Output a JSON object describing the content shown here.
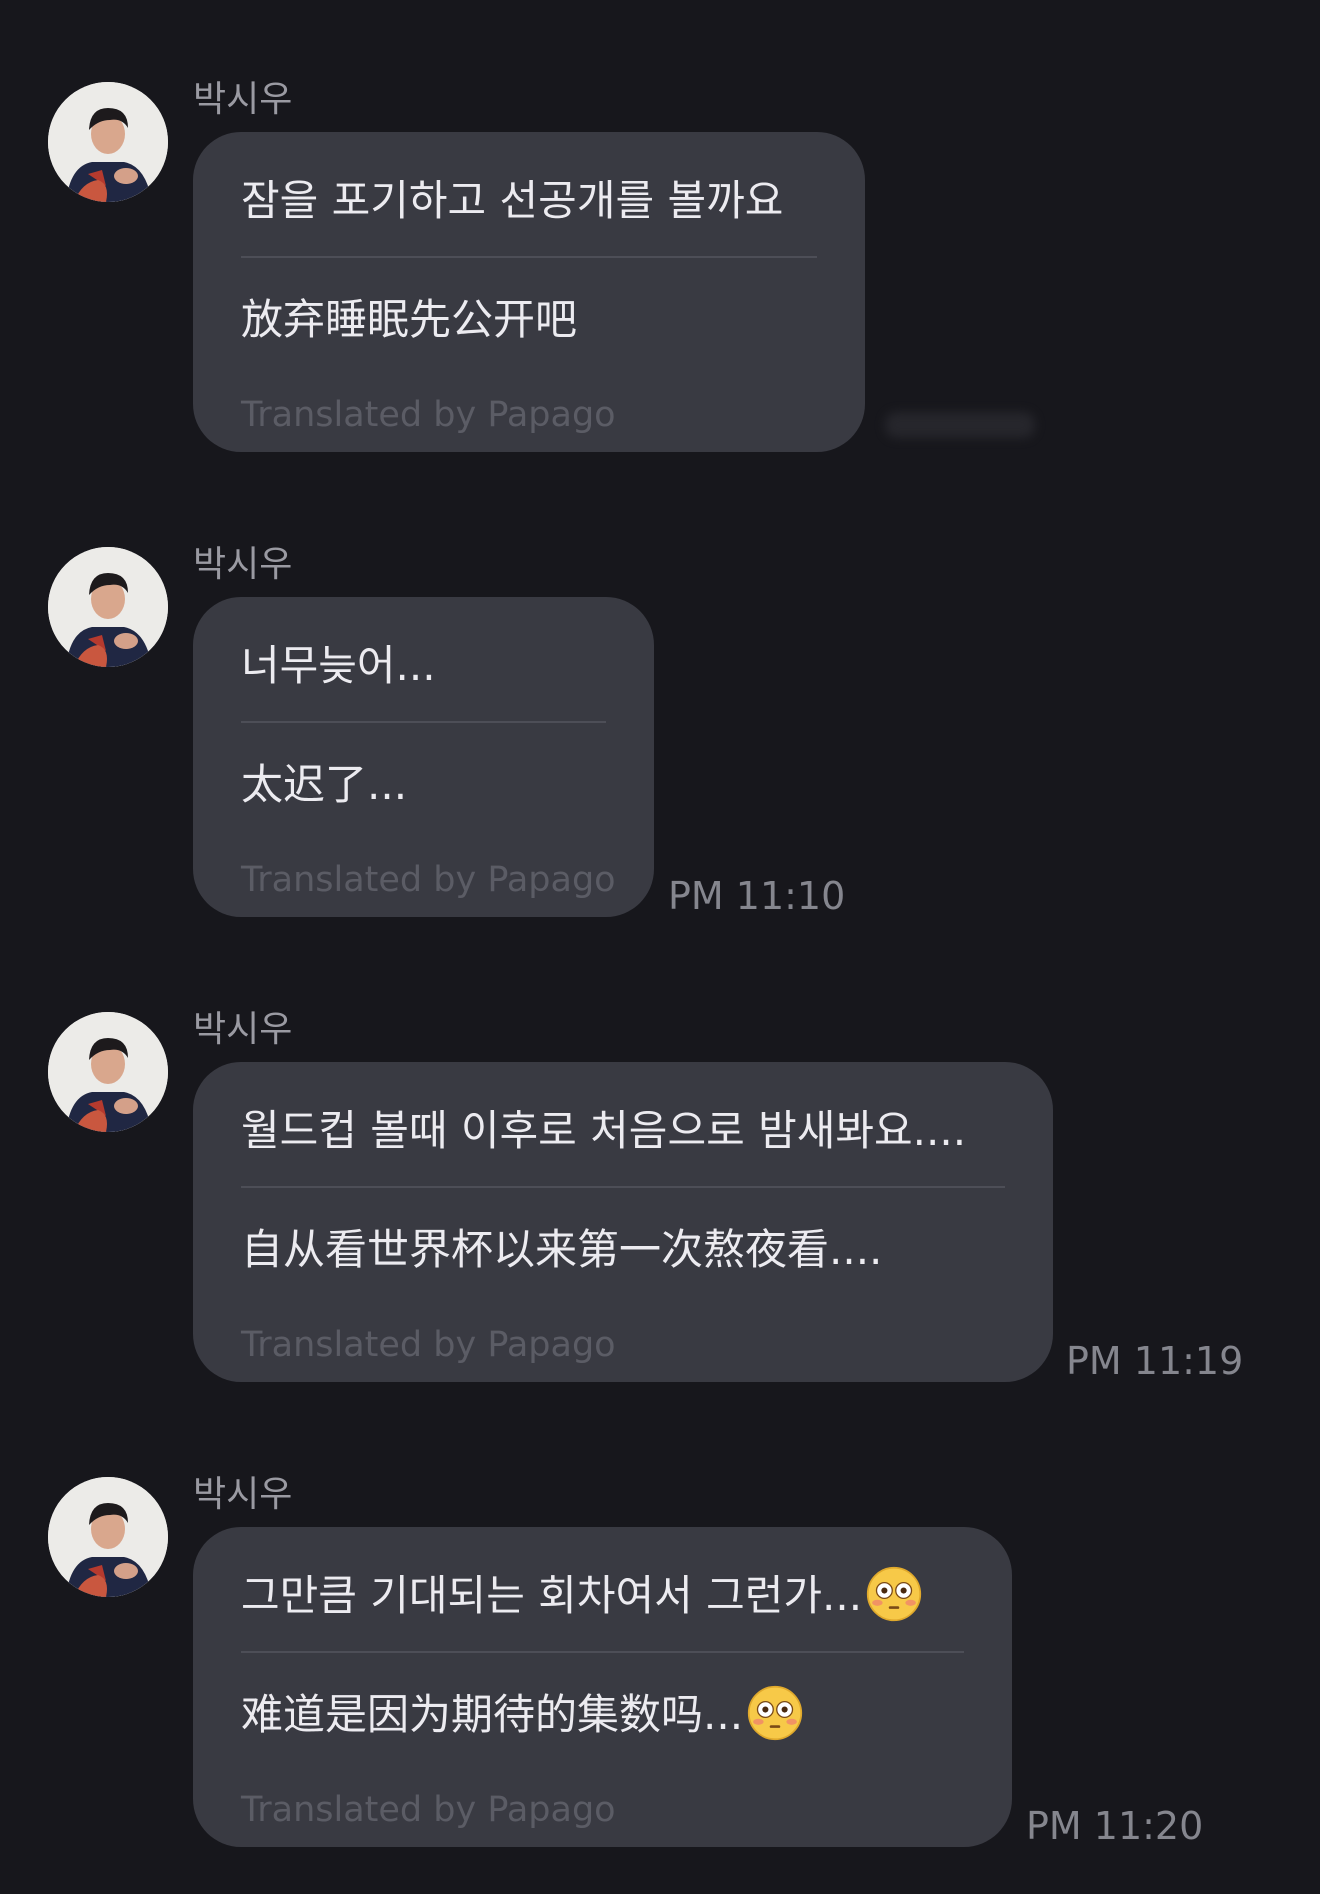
{
  "sender_name": "박시우",
  "translation_credit": "Translated by Papago",
  "messages": [
    {
      "original": "잠을 포기하고 선공개를 볼까요",
      "translation": "放弃睡眠先公开吧",
      "time": ""
    },
    {
      "original": "너무늦어...",
      "translation": "太迟了...",
      "time": "PM 11:10"
    },
    {
      "original": "월드컵 볼때 이후로 처음으로 밤새봐요....",
      "translation": "自从看世界杯以来第一次熬夜看....",
      "time": "PM 11:19"
    },
    {
      "original": "그만큼 기대되는 회차여서 그런가...",
      "translation": "难道是因为期待的集数吗...",
      "time": "PM 11:20",
      "emoji": "flushed-face"
    }
  ],
  "colors": {
    "background": "#17171c",
    "bubble": "#393a42",
    "text": "#ecebf0",
    "sender": "#9a9aa2",
    "credit": "#5b5c65",
    "timestamp": "#85868e"
  }
}
